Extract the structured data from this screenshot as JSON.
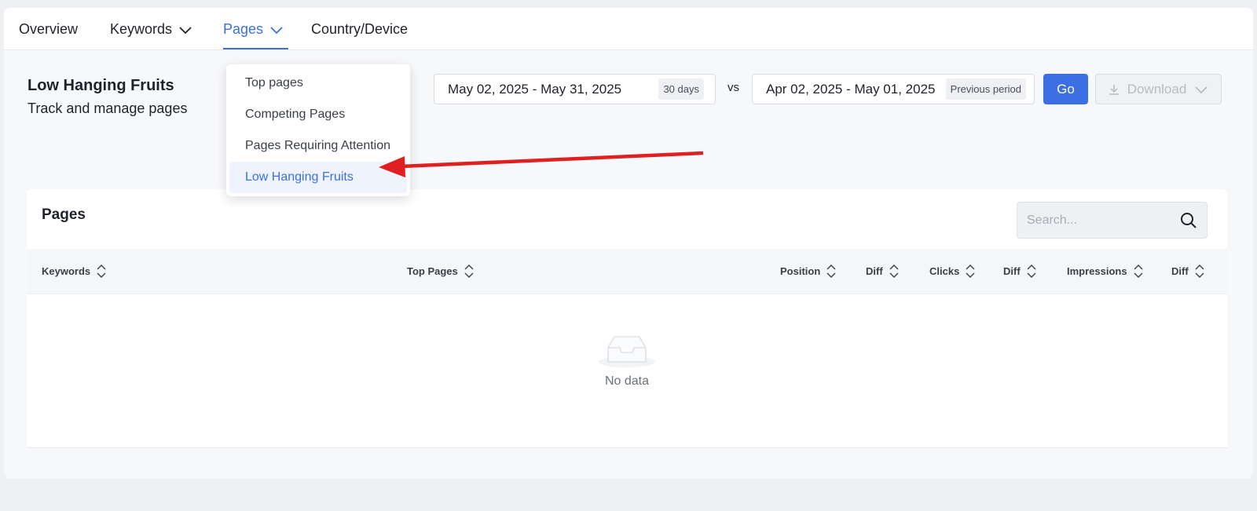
{
  "nav": {
    "overview": "Overview",
    "keywords": "Keywords",
    "pages": "Pages",
    "country_device": "Country/Device"
  },
  "header": {
    "title": "Low Hanging Fruits",
    "subtitle": "Track and manage pages"
  },
  "date_range": {
    "current": "May 02, 2025 - May 31, 2025",
    "current_tag": "30 days",
    "vs": "vs",
    "previous": "Apr 02, 2025 - May 01, 2025",
    "previous_tag": "Previous period"
  },
  "buttons": {
    "go": "Go",
    "download": "Download"
  },
  "pages_dropdown": {
    "items": [
      "Top pages",
      "Competing Pages",
      "Pages Requiring Attention",
      "Low Hanging Fruits"
    ],
    "selected": "Low Hanging Fruits"
  },
  "panel": {
    "title": "Pages",
    "search_placeholder": "Search...",
    "columns": [
      "Keywords",
      "Top Pages",
      "Position",
      "Diff",
      "Clicks",
      "Diff",
      "Impressions",
      "Diff"
    ],
    "empty_text": "No data"
  },
  "colors": {
    "accent": "#3b6fe3",
    "arrow": "#e02020"
  }
}
